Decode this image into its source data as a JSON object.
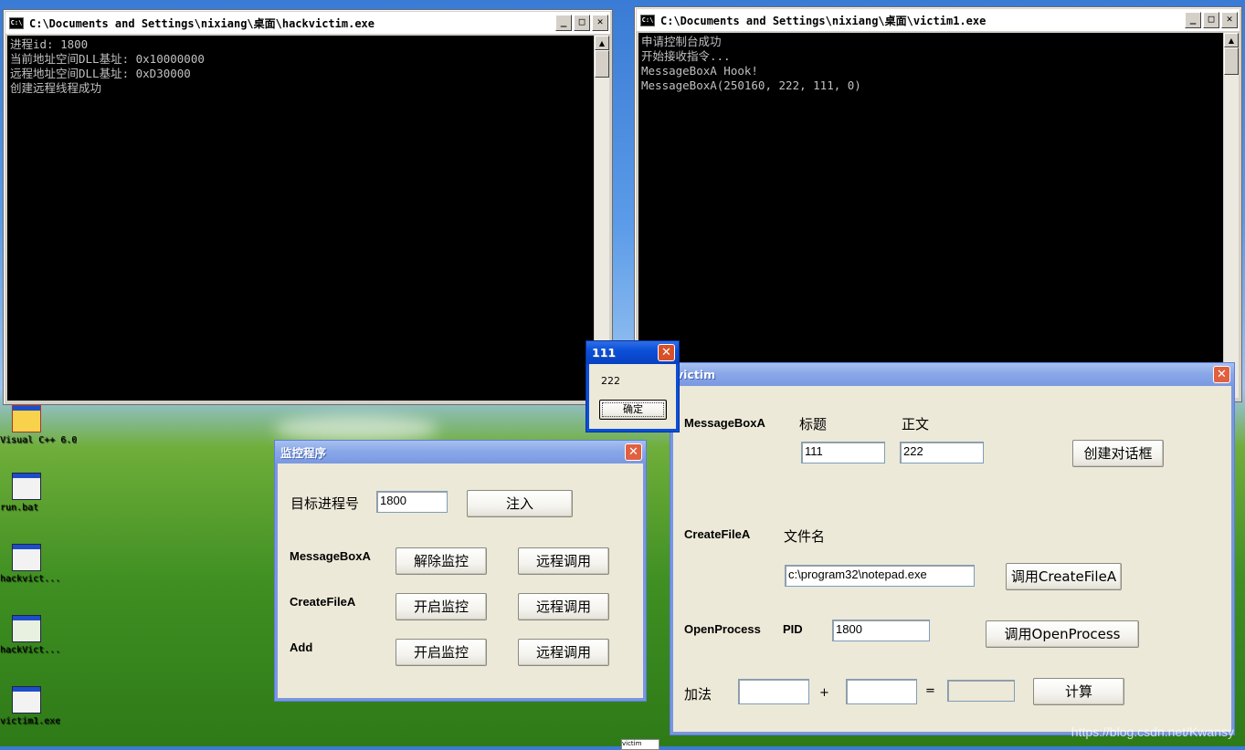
{
  "desktop": {
    "icons": [
      {
        "label": "Visual C++ 6.0",
        "icon": "visual-cpp-icon"
      },
      {
        "label": "run.bat",
        "icon": "batch-file-icon"
      },
      {
        "label": "hackvict...",
        "icon": "exe-window-icon"
      },
      {
        "label": "hackVict...",
        "icon": "recycle-file-icon"
      },
      {
        "label": "victim1.exe",
        "icon": "exe-window-icon"
      }
    ],
    "watermark": "https://blog.csdn.net/Kwansy"
  },
  "console_left": {
    "title": "C:\\Documents and Settings\\nixiang\\桌面\\hackvictim.exe",
    "lines": [
      "进程id: 1800",
      "当前地址空间DLL基址: 0x10000000",
      "远程地址空间DLL基址: 0xD30000",
      "创建远程线程成功"
    ]
  },
  "console_right": {
    "title": "C:\\Documents and Settings\\nixiang\\桌面\\victim1.exe",
    "lines": [
      "申请控制台成功",
      "开始接收指令...",
      "MessageBoxA Hook!",
      "MessageBoxA(250160, 222, 111, 0)"
    ]
  },
  "message_box": {
    "title": "111",
    "text": "222",
    "ok_label": "确定"
  },
  "monitor_dialog": {
    "title": "监控程序",
    "pid_label": "目标进程号",
    "pid_value": "1800",
    "inject_label": "注入",
    "rows": [
      {
        "api": "MessageBoxA",
        "toggle_label": "解除监控",
        "call_label": "远程调用"
      },
      {
        "api": "CreateFileA",
        "toggle_label": "开启监控",
        "call_label": "远程调用"
      },
      {
        "api": "Add",
        "toggle_label": "开启监控",
        "call_label": "远程调用"
      }
    ]
  },
  "victim_dialog": {
    "title": "victim",
    "msgbox_label": "MessageBoxA",
    "caption_label": "标题",
    "text_label": "正文",
    "caption_value": "111",
    "text_value": "222",
    "create_dialog_label": "创建对话框",
    "createfile_label": "CreateFileA",
    "filename_label": "文件名",
    "filename_value": "c:\\program32\\notepad.exe",
    "call_createfile_label": "调用CreateFileA",
    "openprocess_label": "OpenProcess",
    "pid_label": "PID",
    "pid_value": "1800",
    "call_openprocess_label": "调用OpenProcess",
    "add_label": "加法",
    "add_a": "",
    "plus": "+",
    "add_b": "",
    "equals": "=",
    "add_result": "",
    "compute_label": "计算"
  },
  "taskbar_stub": {
    "label": "victim"
  },
  "colors": {
    "console_bg": "#000000",
    "console_text": "#c0c0c0",
    "xp_titlebar": "#0a50d8",
    "xp_inactive_titlebar": "#8aa8e8",
    "dialog_bg": "#ece9d8",
    "close_button": "#e06040"
  }
}
